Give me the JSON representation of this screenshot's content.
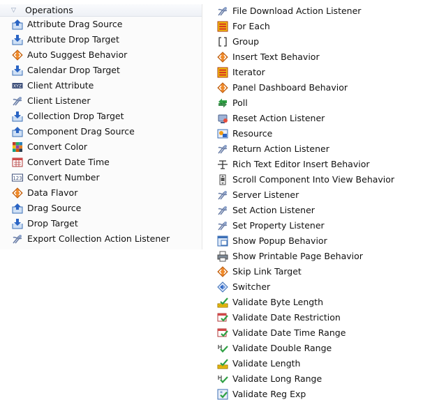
{
  "left": {
    "header": "Operations",
    "items": [
      {
        "label": "Attribute Drag Source",
        "icon": "drag-source-icon"
      },
      {
        "label": "Attribute Drop Target",
        "icon": "drop-target-icon"
      },
      {
        "label": "Auto Suggest Behavior",
        "icon": "behavior-icon"
      },
      {
        "label": "Calendar Drop Target",
        "icon": "drop-target-icon"
      },
      {
        "label": "Client Attribute",
        "icon": "xyz-icon"
      },
      {
        "label": "Client Listener",
        "icon": "listener-icon"
      },
      {
        "label": "Collection Drop Target",
        "icon": "drop-target-icon"
      },
      {
        "label": "Component Drag Source",
        "icon": "drag-source-icon"
      },
      {
        "label": "Convert Color",
        "icon": "color-grid-icon"
      },
      {
        "label": "Convert Date Time",
        "icon": "date-time-icon"
      },
      {
        "label": "Convert Number",
        "icon": "number-icon"
      },
      {
        "label": "Data Flavor",
        "icon": "behavior-icon"
      },
      {
        "label": "Drag Source",
        "icon": "drag-source-icon"
      },
      {
        "label": "Drop Target",
        "icon": "drop-target-icon"
      },
      {
        "label": "Export Collection Action Listener",
        "icon": "listener-icon"
      }
    ]
  },
  "right": {
    "items": [
      {
        "label": "File Download Action Listener",
        "icon": "listener-icon"
      },
      {
        "label": "For Each",
        "icon": "iterator-icon"
      },
      {
        "label": "Group",
        "icon": "bracket-icon"
      },
      {
        "label": "Insert Text Behavior",
        "icon": "behavior-icon"
      },
      {
        "label": "Iterator",
        "icon": "iterator-icon"
      },
      {
        "label": "Panel Dashboard Behavior",
        "icon": "behavior-icon"
      },
      {
        "label": "Poll",
        "icon": "poll-icon"
      },
      {
        "label": "Reset Action Listener",
        "icon": "reset-icon"
      },
      {
        "label": "Resource",
        "icon": "resource-icon"
      },
      {
        "label": "Return Action Listener",
        "icon": "listener-icon"
      },
      {
        "label": "Rich Text Editor Insert Behavior",
        "icon": "text-cursor-icon"
      },
      {
        "label": "Scroll Component Into View Behavior",
        "icon": "scroll-icon"
      },
      {
        "label": "Server Listener",
        "icon": "listener-icon"
      },
      {
        "label": "Set Action Listener",
        "icon": "listener-icon"
      },
      {
        "label": "Set Property Listener",
        "icon": "listener-icon"
      },
      {
        "label": "Show Popup Behavior",
        "icon": "popup-icon"
      },
      {
        "label": "Show Printable Page Behavior",
        "icon": "printer-icon"
      },
      {
        "label": "Skip Link Target",
        "icon": "behavior-icon"
      },
      {
        "label": "Switcher",
        "icon": "switcher-icon"
      },
      {
        "label": "Validate Byte Length",
        "icon": "validate-length-icon"
      },
      {
        "label": "Validate Date Restriction",
        "icon": "validate-date-icon"
      },
      {
        "label": "Validate Date Time Range",
        "icon": "validate-date-icon"
      },
      {
        "label": "Validate Double Range",
        "icon": "validate-range-icon"
      },
      {
        "label": "Validate Length",
        "icon": "validate-length-icon"
      },
      {
        "label": "Validate Long Range",
        "icon": "validate-range-icon"
      },
      {
        "label": "Validate Reg Exp",
        "icon": "validate-regexp-icon"
      }
    ]
  }
}
